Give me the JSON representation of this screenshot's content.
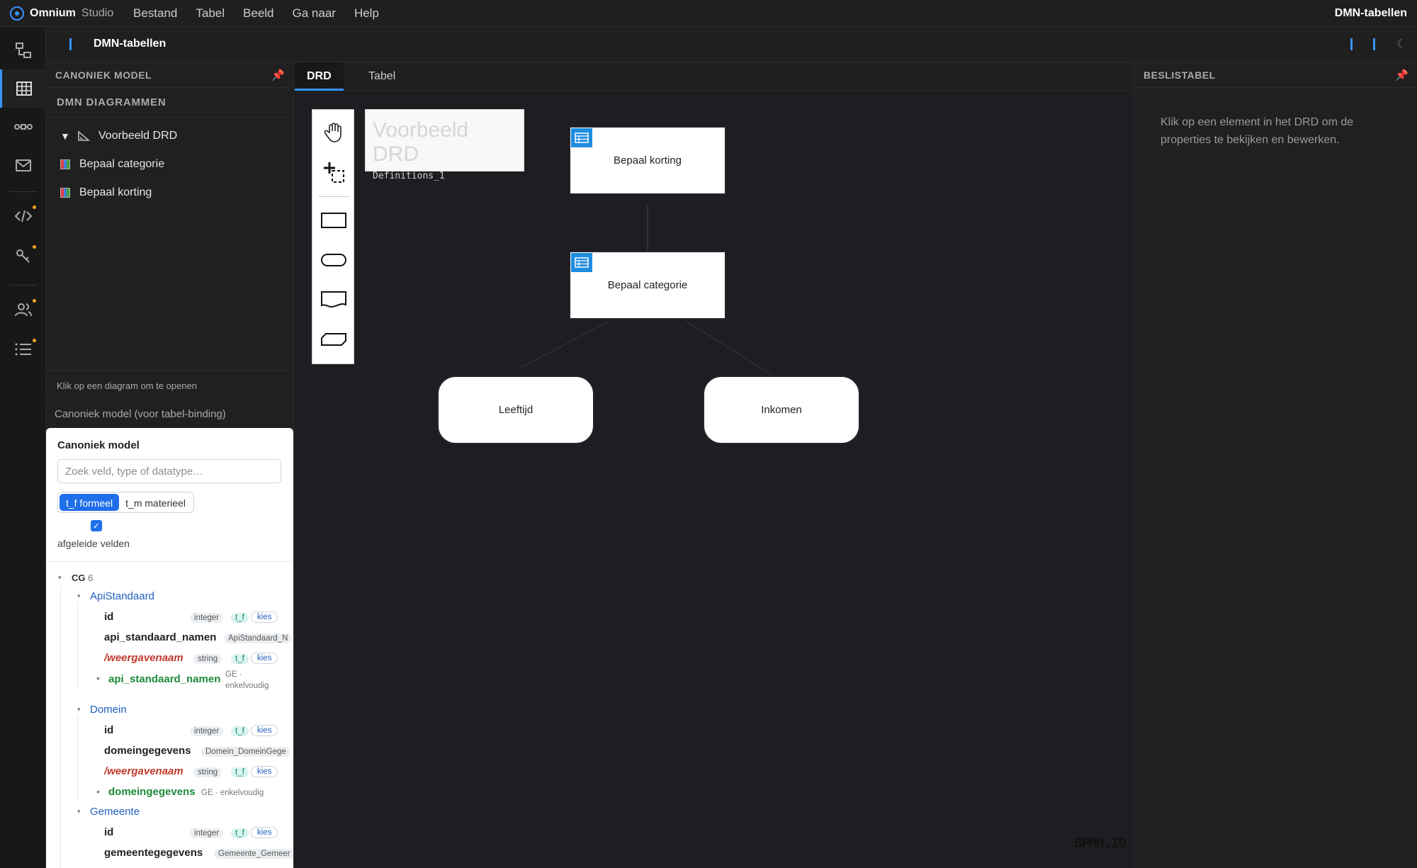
{
  "app": {
    "brand_name": "Omnium",
    "brand_sub": "Studio",
    "window_title": "DMN-tabellen"
  },
  "menu": [
    "Bestand",
    "Tabel",
    "Beeld",
    "Ga naar",
    "Help"
  ],
  "editor_header": {
    "title": "DMN-tabellen"
  },
  "left_panel": {
    "title": "CANONIEK MODEL",
    "section": "DMN DIAGRAMMEN",
    "tree": [
      {
        "label": "Voorbeeld DRD",
        "kind": "drd",
        "expanded": true
      },
      {
        "label": "Bepaal categorie",
        "kind": "table"
      },
      {
        "label": "Bepaal korting",
        "kind": "table"
      }
    ],
    "hint": "Klik op een diagram om te openen",
    "canon_header": "Canoniek model (voor tabel-binding)"
  },
  "canon": {
    "title": "Canoniek model",
    "search_placeholder": "Zoek veld, type of datatype…",
    "toggle": {
      "on": "t_f formeel",
      "off": "t_m materieel"
    },
    "checkbox_checked": true,
    "checkbox_label": "afgeleide velden",
    "group": {
      "name": "CG",
      "count": "6"
    },
    "entities": [
      {
        "name": "ApiStandaard",
        "fields": [
          {
            "name": "id",
            "type": "integer",
            "tf": "t_f",
            "action": "kies",
            "kind": "plain"
          },
          {
            "name": "api_standaard_namen",
            "type": "ApiStandaard_N",
            "kind": "plain"
          },
          {
            "name": "/weergavenaam",
            "type": "string",
            "tf": "t_f",
            "action": "kies",
            "kind": "derived"
          },
          {
            "name": "api_standaard_namen",
            "meta1": "GE ·",
            "meta2": "enkelvoudig",
            "kind": "ref"
          }
        ]
      },
      {
        "name": "Domein",
        "fields": [
          {
            "name": "id",
            "type": "integer",
            "tf": "t_f",
            "action": "kies",
            "kind": "plain"
          },
          {
            "name": "domeingegevens",
            "type": "Domein_DomeinGege",
            "kind": "plain"
          },
          {
            "name": "/weergavenaam",
            "type": "string",
            "tf": "t_f",
            "action": "kies",
            "kind": "derived"
          },
          {
            "name": "domeingegevens",
            "meta": "GE · enkelvoudig",
            "kind": "ref"
          }
        ]
      },
      {
        "name": "Gemeente",
        "fields": [
          {
            "name": "id",
            "type": "integer",
            "tf": "t_f",
            "action": "kies",
            "kind": "plain"
          },
          {
            "name": "gemeentegegevens",
            "type": "Gemeente_Gemeer",
            "kind": "plain"
          }
        ]
      }
    ]
  },
  "tabs": [
    {
      "label": "DRD",
      "active": true
    },
    {
      "label": "Tabel",
      "active": false
    }
  ],
  "drd": {
    "name": "Voorbeeld DRD",
    "id": "Definitions_1",
    "decisions": [
      "Bepaal korting",
      "Bepaal categorie"
    ],
    "inputs": [
      "Leeftijd",
      "Inkomen"
    ],
    "watermark": "BPMN.IO"
  },
  "right_panel": {
    "title": "BESLISTABEL",
    "hint": "Klik op een element in het DRD om de properties te bekijken en bewerken."
  },
  "colors": {
    "accent": "#3794ff",
    "pin": "#e0245e",
    "toggle_on": "#1f6feb",
    "decision_icon": "#1f8de0"
  }
}
